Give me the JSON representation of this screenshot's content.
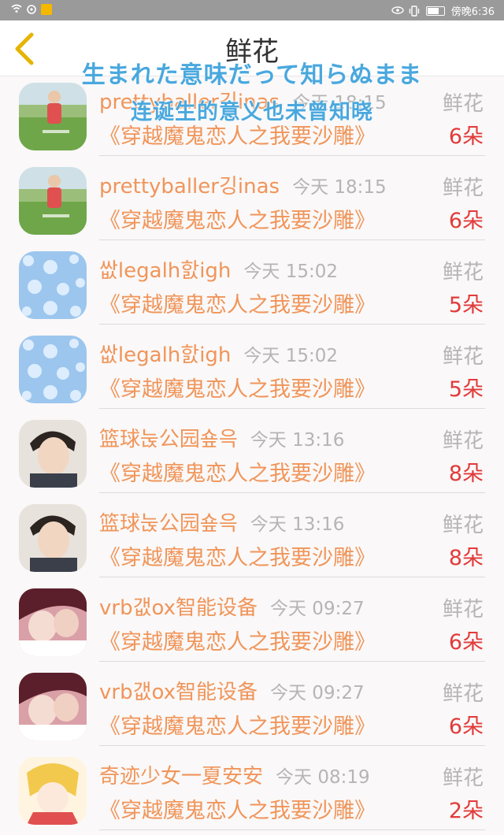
{
  "status_bar": {
    "carrier_time": "傍晚6:36",
    "icons": [
      "wifi-icon",
      "sync-icon",
      "app-badge-icon",
      "eye-icon",
      "vibrate-icon",
      "battery-icon"
    ]
  },
  "header": {
    "title": "鲜花",
    "back_icon": "chevron-left-icon"
  },
  "overlay": {
    "line1": "生まれた意味だって知らぬまま",
    "line2": "连诞生的意义也未曾知晓"
  },
  "colors": {
    "accent": "#f0955a",
    "count": "#e23a3a",
    "muted": "#b5b5b5",
    "overlay": "#4aa8de"
  },
  "list": {
    "items": [
      {
        "name": "prettyballer깅inas",
        "time": "今天 18:15",
        "gift": "鲜花",
        "book": "《穿越魔鬼恋人之我要沙雕》",
        "count": "6朵",
        "avatar": "landscape"
      },
      {
        "name": "prettyballer깅inas",
        "time": "今天 18:15",
        "gift": "鲜花",
        "book": "《穿越魔鬼恋人之我要沙雕》",
        "count": "6朵",
        "avatar": "landscape"
      },
      {
        "name": "쌊legalh핤igh",
        "time": "今天 15:02",
        "gift": "鲜花",
        "book": "《穿越魔鬼恋人之我要沙雕》",
        "count": "5朵",
        "avatar": "snow"
      },
      {
        "name": "쌊legalh핤igh",
        "time": "今天 15:02",
        "gift": "鲜花",
        "book": "《穿越魔鬼恋人之我要沙雕》",
        "count": "5朵",
        "avatar": "snow"
      },
      {
        "name": "篮球눉公园숖윽",
        "time": "今天 13:16",
        "gift": "鲜花",
        "book": "《穿越魔鬼恋人之我要沙雕》",
        "count": "8朵",
        "avatar": "boy"
      },
      {
        "name": "篮球눉公园숖윽",
        "time": "今天 13:16",
        "gift": "鲜花",
        "book": "《穿越魔鬼恋人之我要沙雕》",
        "count": "8朵",
        "avatar": "boy"
      },
      {
        "name": "vrb갮ox智能设备",
        "time": "今天 09:27",
        "gift": "鲜花",
        "book": "《穿越魔鬼恋人之我要沙雕》",
        "count": "6朵",
        "avatar": "couple"
      },
      {
        "name": "vrb갮ox智能设备",
        "time": "今天 09:27",
        "gift": "鲜花",
        "book": "《穿越魔鬼恋人之我要沙雕》",
        "count": "6朵",
        "avatar": "couple"
      },
      {
        "name": "奇迹少女一夏安安",
        "time": "今天 08:19",
        "gift": "鲜花",
        "book": "《穿越魔鬼恋人之我要沙雕》",
        "count": "2朵",
        "avatar": "anime"
      }
    ]
  }
}
